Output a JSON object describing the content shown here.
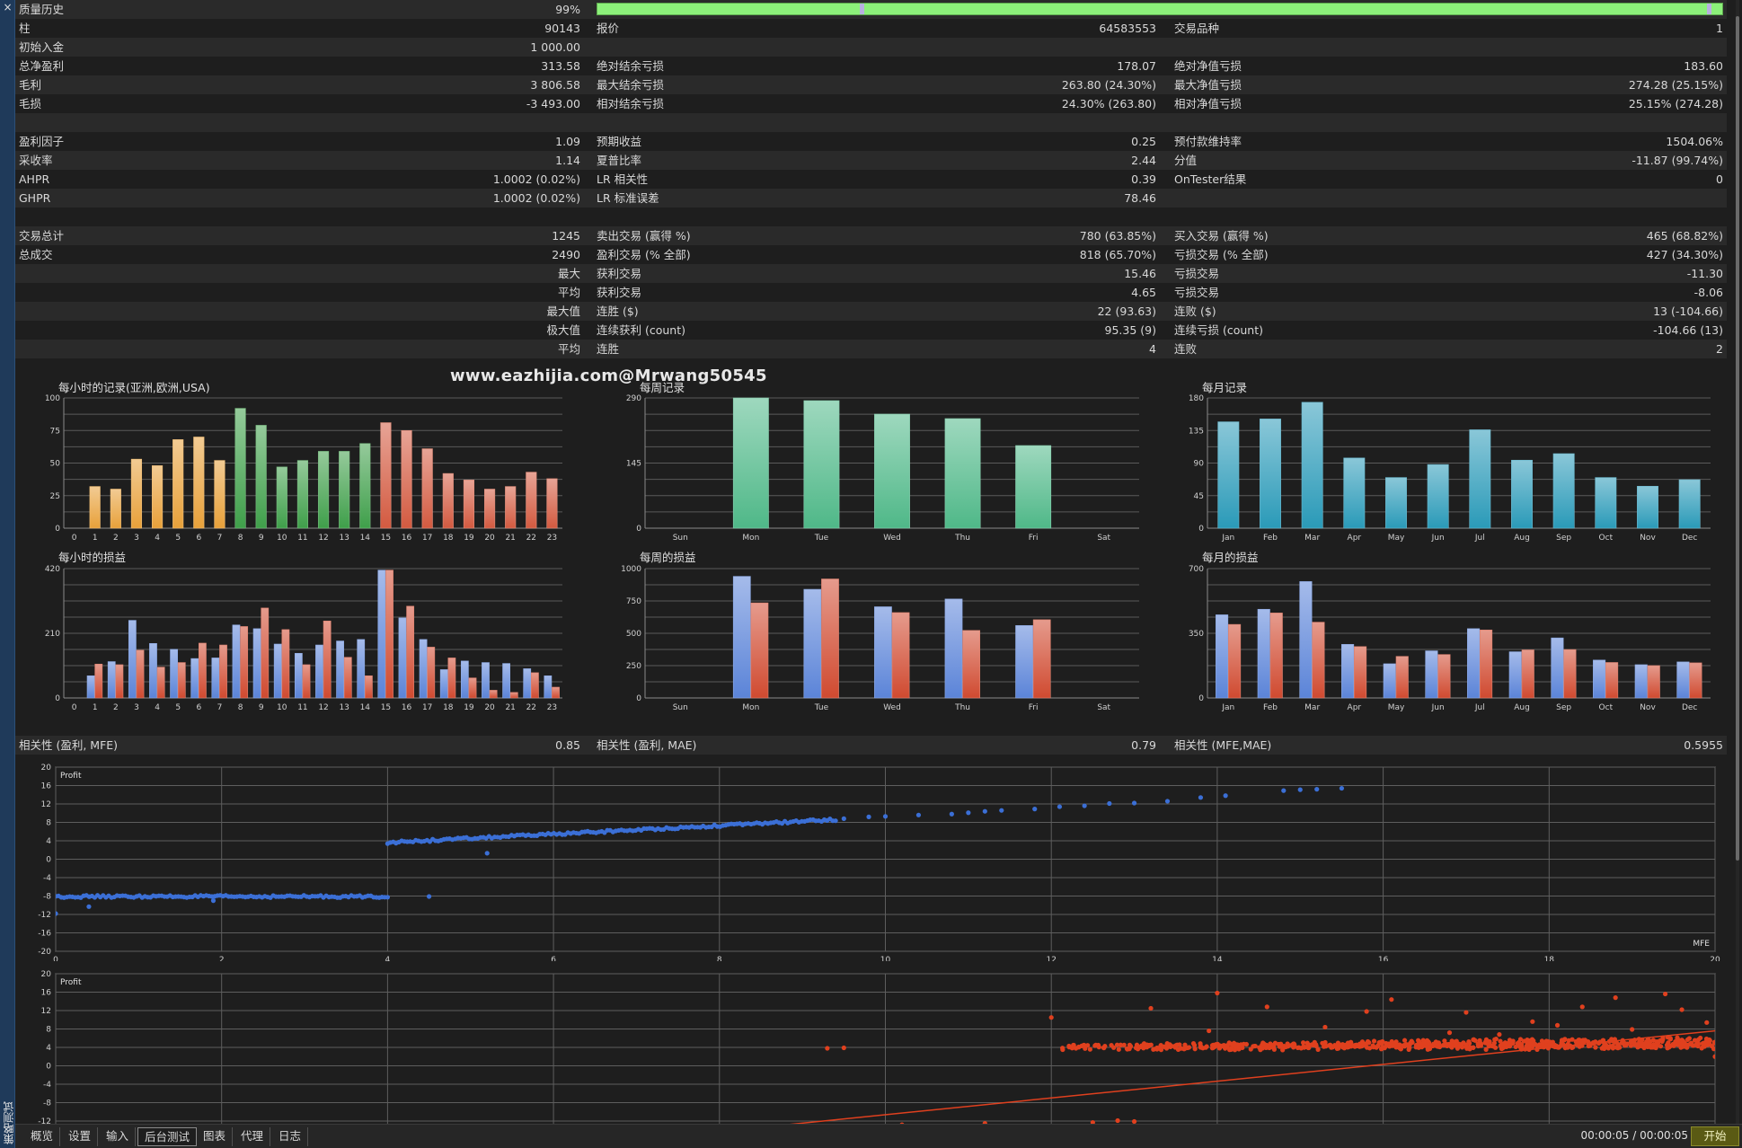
{
  "window": {
    "vertical_title": "策略测试",
    "close_icon": "×"
  },
  "stats_rows": [
    {
      "stripe": true,
      "cells": [
        "质量历史",
        "99%",
        "",
        "",
        "",
        ""
      ],
      "quality_bar": true
    },
    {
      "stripe": false,
      "cells": [
        "柱",
        "90143",
        "报价",
        "64583553",
        "交易品种",
        "1"
      ]
    },
    {
      "stripe": true,
      "cells": [
        "初始入金",
        "1 000.00",
        "",
        "",
        "",
        ""
      ]
    },
    {
      "stripe": false,
      "cells": [
        "总净盈利",
        "313.58",
        "绝对结余亏损",
        "178.07",
        "绝对净值亏损",
        "183.60"
      ]
    },
    {
      "stripe": true,
      "cells": [
        "毛利",
        "3 806.58",
        "最大结余亏损",
        "263.80 (24.30%)",
        "最大净值亏损",
        "274.28 (25.15%)"
      ]
    },
    {
      "stripe": false,
      "cells": [
        "毛损",
        "-3 493.00",
        "相对结余亏损",
        "24.30% (263.80)",
        "相对净值亏损",
        "25.15% (274.28)"
      ]
    },
    {
      "stripe": true,
      "cells": [
        "",
        "",
        "",
        "",
        "",
        ""
      ]
    },
    {
      "stripe": false,
      "cells": [
        "盈利因子",
        "1.09",
        "预期收益",
        "0.25",
        "预付款维持率",
        "1504.06%"
      ]
    },
    {
      "stripe": true,
      "cells": [
        "采收率",
        "1.14",
        "夏普比率",
        "2.44",
        "分值",
        "-11.87 (99.74%)"
      ]
    },
    {
      "stripe": false,
      "cells": [
        "AHPR",
        "1.0002 (0.02%)",
        "LR 相关性",
        "0.39",
        "OnTester结果",
        "0"
      ]
    },
    {
      "stripe": true,
      "cells": [
        "GHPR",
        "1.0002 (0.02%)",
        "LR 标准误差",
        "78.46",
        "",
        ""
      ]
    },
    {
      "stripe": false,
      "cells": [
        "",
        "",
        "",
        "",
        "",
        ""
      ]
    },
    {
      "stripe": true,
      "cells": [
        "交易总计",
        "1245",
        "卖出交易 (赢得 %)",
        "780 (63.85%)",
        "买入交易 (赢得 %)",
        "465 (68.82%)"
      ]
    },
    {
      "stripe": false,
      "cells": [
        "总成交",
        "2490",
        "盈利交易 (% 全部)",
        "818 (65.70%)",
        "亏损交易 (% 全部)",
        "427 (34.30%)"
      ]
    },
    {
      "stripe": true,
      "cells": [
        "",
        "最大",
        "获利交易",
        "15.46",
        "亏损交易",
        "-11.30"
      ]
    },
    {
      "stripe": false,
      "cells": [
        "",
        "平均",
        "获利交易",
        "4.65",
        "亏损交易",
        "-8.06"
      ]
    },
    {
      "stripe": true,
      "cells": [
        "",
        "最大值",
        "连胜 ($)",
        "22 (93.63)",
        "连败 ($)",
        "13 (-104.66)"
      ]
    },
    {
      "stripe": false,
      "cells": [
        "",
        "极大值",
        "连续获利 (count)",
        "95.35 (9)",
        "连续亏损 (count)",
        "-104.66 (13)"
      ]
    },
    {
      "stripe": true,
      "cells": [
        "",
        "平均",
        "连胜",
        "4",
        "连败",
        "2"
      ]
    },
    {
      "stripe": false,
      "cells": [
        "",
        "",
        "",
        "",
        "",
        ""
      ]
    }
  ],
  "watermark": "www.eazhijia.com@Mrwang50545",
  "correlation": {
    "cells": [
      "相关性 (盈利, MFE)",
      "0.85",
      "相关性 (盈利, MAE)",
      "0.79",
      "相关性 (MFE,MAE)",
      "0.5955"
    ]
  },
  "colors": {
    "asia": "#e8a13a",
    "europe": "#3f9f4a",
    "usa": "#d35a40",
    "weekly_bar": "#4fb888",
    "monthly_bar": "#2a9ab8",
    "profit_bar": "#5b84d8",
    "loss_bar": "#d04a30",
    "mfe_dot": "#3b6fd6",
    "mae_dot": "#e0401e",
    "quality_bar": "#8cf07a"
  },
  "chart_data": [
    {
      "id": "hourly-records",
      "type": "bar",
      "title": "每小时的记录(亚洲,欧洲,USA)",
      "categories": [
        "0",
        "1",
        "2",
        "3",
        "4",
        "5",
        "6",
        "7",
        "8",
        "9",
        "10",
        "11",
        "12",
        "13",
        "14",
        "15",
        "16",
        "17",
        "18",
        "19",
        "20",
        "21",
        "22",
        "23"
      ],
      "values": [
        0,
        32,
        30,
        53,
        48,
        68,
        70,
        52,
        92,
        79,
        47,
        52,
        59,
        59,
        65,
        81,
        75,
        61,
        42,
        37,
        30,
        32,
        43,
        38
      ],
      "groups": [
        "asia",
        "asia",
        "asia",
        "asia",
        "asia",
        "asia",
        "asia",
        "asia",
        "europe",
        "europe",
        "europe",
        "europe",
        "europe",
        "europe",
        "europe",
        "usa",
        "usa",
        "usa",
        "usa",
        "usa",
        "usa",
        "usa",
        "usa",
        "usa"
      ],
      "ylim": [
        0,
        100
      ],
      "yticks": [
        0,
        25,
        50,
        75,
        100
      ]
    },
    {
      "id": "weekly-records",
      "type": "bar",
      "title": "每周记录",
      "categories": [
        "Sun",
        "Mon",
        "Tue",
        "Wed",
        "Thu",
        "Fri",
        "Sat"
      ],
      "values": [
        0,
        290,
        284,
        254,
        244,
        184,
        0
      ],
      "ylim": [
        0,
        290
      ],
      "yticks": [
        0,
        145,
        290
      ]
    },
    {
      "id": "monthly-records",
      "type": "bar",
      "title": "每月记录",
      "categories": [
        "Jan",
        "Feb",
        "Mar",
        "Apr",
        "May",
        "Jun",
        "Jul",
        "Aug",
        "Sep",
        "Oct",
        "Nov",
        "Dec"
      ],
      "values": [
        147,
        151,
        174,
        97,
        70,
        88,
        136,
        94,
        103,
        70,
        58,
        67
      ],
      "ylim": [
        0,
        180
      ],
      "yticks": [
        0,
        45,
        90,
        135,
        180
      ]
    },
    {
      "id": "hourly-pnl",
      "type": "bar",
      "title": "每小时的损益",
      "categories": [
        "0",
        "1",
        "2",
        "3",
        "4",
        "5",
        "6",
        "7",
        "8",
        "9",
        "10",
        "11",
        "12",
        "13",
        "14",
        "15",
        "16",
        "17",
        "18",
        "19",
        "20",
        "21",
        "22",
        "23"
      ],
      "series": [
        {
          "name": "profit",
          "values": [
            0,
            72,
            118,
            252,
            177,
            158,
            128,
            130,
            237,
            225,
            175,
            145,
            172,
            185,
            190,
            415,
            260,
            190,
            92,
            120,
            115,
            112,
            95,
            72
          ]
        },
        {
          "name": "loss",
          "values": [
            0,
            110,
            108,
            155,
            100,
            115,
            178,
            172,
            232,
            292,
            222,
            108,
            250,
            132,
            72,
            415,
            298,
            165,
            130,
            65,
            25,
            18,
            82,
            35
          ]
        }
      ],
      "ylim": [
        0,
        420
      ],
      "yticks": [
        0,
        210,
        420
      ]
    },
    {
      "id": "weekly-pnl",
      "type": "bar",
      "title": "每周的损益",
      "categories": [
        "Sun",
        "Mon",
        "Tue",
        "Wed",
        "Thu",
        "Fri",
        "Sat"
      ],
      "series": [
        {
          "name": "profit",
          "values": [
            0,
            940,
            840,
            705,
            765,
            560,
            0
          ]
        },
        {
          "name": "loss",
          "values": [
            0,
            735,
            920,
            660,
            522,
            605,
            0
          ]
        }
      ],
      "ylim": [
        0,
        1000
      ],
      "yticks": [
        0,
        250,
        500,
        750,
        1000
      ]
    },
    {
      "id": "monthly-pnl",
      "type": "bar",
      "title": "每月的损益",
      "categories": [
        "Jan",
        "Feb",
        "Mar",
        "Apr",
        "May",
        "Jun",
        "Jul",
        "Aug",
        "Sep",
        "Oct",
        "Nov",
        "Dec"
      ],
      "series": [
        {
          "name": "profit",
          "values": [
            450,
            480,
            630,
            290,
            185,
            255,
            375,
            250,
            325,
            205,
            180,
            195
          ]
        },
        {
          "name": "loss",
          "values": [
            398,
            460,
            410,
            278,
            225,
            235,
            368,
            260,
            262,
            192,
            175,
            190
          ]
        }
      ],
      "ylim": [
        0,
        700
      ],
      "yticks": [
        0,
        350,
        700
      ]
    },
    {
      "id": "scatter-profit-mfe",
      "type": "scatter",
      "ylabel": "Profit",
      "xlabel": "MFE",
      "xlim": [
        0,
        20
      ],
      "ylim": [
        -20,
        20
      ],
      "xticks": [
        0,
        2,
        4,
        6,
        8,
        10,
        12,
        14,
        16,
        18,
        20
      ],
      "yticks": [
        -20,
        -16,
        -12,
        -8,
        -4,
        0,
        4,
        8,
        12,
        16,
        20
      ],
      "segments": [
        {
          "x0": 0,
          "y0": -8.1,
          "x1": 4,
          "y1": -8.1,
          "n": 120
        },
        {
          "x0": 4,
          "y0": 3.6,
          "x1": 9.4,
          "y1": 8.6,
          "n": 160
        }
      ],
      "points": [
        [
          0,
          -11.8
        ],
        [
          0.4,
          -10.3
        ],
        [
          1.9,
          -9.0
        ],
        [
          4.5,
          -8.1
        ],
        [
          5.2,
          1.3
        ],
        [
          9.5,
          8.8
        ],
        [
          9.8,
          9.2
        ],
        [
          10.0,
          9.3
        ],
        [
          10.4,
          9.6
        ],
        [
          10.8,
          9.8
        ],
        [
          11.0,
          10.1
        ],
        [
          11.2,
          10.4
        ],
        [
          11.4,
          10.6
        ],
        [
          11.8,
          10.9
        ],
        [
          12.1,
          11.4
        ],
        [
          12.4,
          11.6
        ],
        [
          12.7,
          12.1
        ],
        [
          13.0,
          12.2
        ],
        [
          13.4,
          12.6
        ],
        [
          13.8,
          13.4
        ],
        [
          14.1,
          13.8
        ],
        [
          14.8,
          14.9
        ],
        [
          15.0,
          15.1
        ],
        [
          15.2,
          15.2
        ],
        [
          15.5,
          15.4
        ]
      ]
    },
    {
      "id": "scatter-profit-mae",
      "type": "scatter",
      "ylabel": "Profit",
      "xlabel": "",
      "xlim": [
        0,
        20
      ],
      "ylim": [
        -20,
        20
      ],
      "xticks": [],
      "yticks": [
        -12,
        -8,
        -4,
        0,
        4,
        8,
        12,
        16,
        20
      ],
      "dense_band": {
        "x0": 12,
        "x1": 20,
        "y0": 3.4,
        "y1": 4.6,
        "n": 700
      },
      "points": [
        [
          8.7,
          -13.8
        ],
        [
          9.3,
          3.8
        ],
        [
          9.5,
          3.9
        ],
        [
          10.2,
          -12.8
        ],
        [
          12.0,
          10.5
        ],
        [
          13.2,
          12.5
        ],
        [
          14.0,
          15.8
        ],
        [
          14.6,
          12.8
        ],
        [
          15.8,
          11.8
        ],
        [
          16.1,
          14.4
        ],
        [
          17.0,
          11.6
        ],
        [
          17.8,
          9.6
        ],
        [
          18.4,
          12.8
        ],
        [
          18.8,
          14.8
        ],
        [
          19.4,
          15.6
        ],
        [
          19.6,
          12.2
        ],
        [
          19.9,
          9.4
        ],
        [
          20.0,
          2.0
        ],
        [
          16.8,
          7.2
        ],
        [
          15.3,
          8.4
        ],
        [
          13.9,
          7.6
        ],
        [
          18.1,
          8.8
        ],
        [
          19.0,
          7.9
        ],
        [
          17.4,
          6.8
        ],
        [
          12.5,
          -12.3
        ],
        [
          12.8,
          -11.9
        ],
        [
          13.0,
          -12.1
        ],
        [
          11.2,
          -12.5
        ]
      ],
      "trend": {
        "x0": 8.7,
        "y0": -13.0,
        "x1": 20.0,
        "y1": 7.6
      }
    }
  ],
  "bottom_tabs": [
    {
      "label": "概览",
      "active": false
    },
    {
      "label": "设置",
      "active": false
    },
    {
      "label": "输入",
      "active": false
    },
    {
      "label": "后台测试",
      "active": true
    },
    {
      "label": "图表",
      "active": false
    },
    {
      "label": "代理",
      "active": false
    },
    {
      "label": "日志",
      "active": false
    }
  ],
  "timer": "00:00:05 / 00:00:05",
  "start_button": "开始"
}
